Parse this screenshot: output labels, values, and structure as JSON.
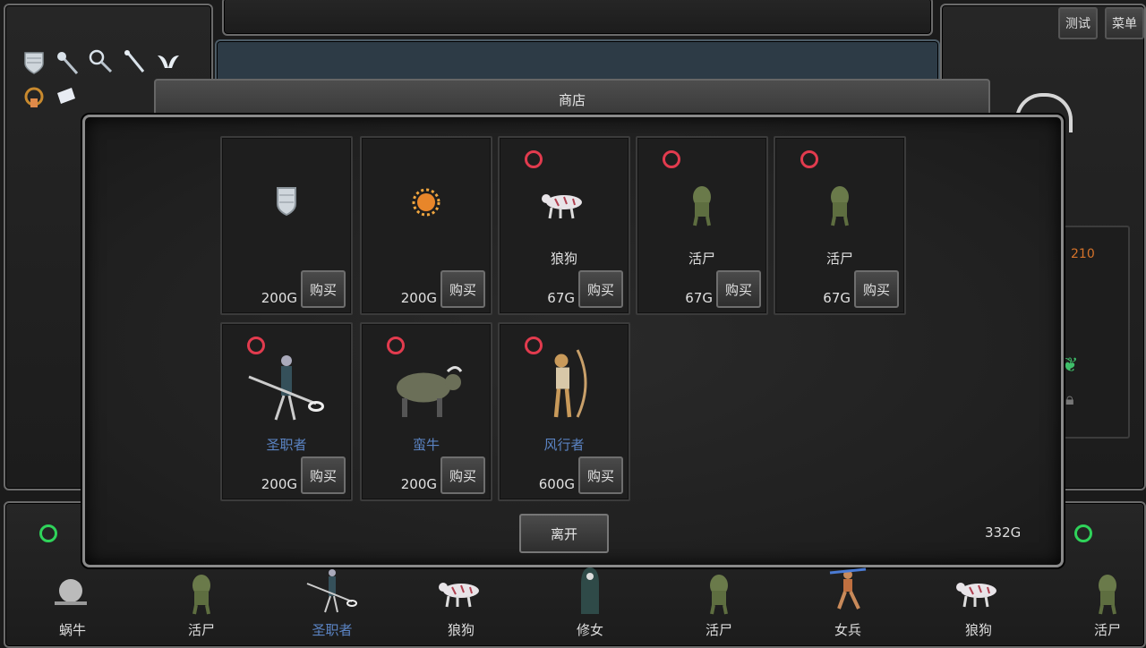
{
  "top_buttons": {
    "test": "测试",
    "menu": "菜单"
  },
  "shop": {
    "title": "商店",
    "leave_label": "离开",
    "player_gold": "332G",
    "items": [
      {
        "name": "",
        "price": "200G",
        "buy": "购买",
        "icon": "shield-icon",
        "marked": false
      },
      {
        "name": "",
        "price": "200G",
        "buy": "购买",
        "icon": "orange-burst-icon",
        "marked": false
      },
      {
        "name": "狼狗",
        "price": "67G",
        "buy": "购买",
        "icon": "wolf-dog-icon",
        "marked": true
      },
      {
        "name": "活尸",
        "price": "67G",
        "buy": "购买",
        "icon": "zombie-icon",
        "marked": true
      },
      {
        "name": "活尸",
        "price": "67G",
        "buy": "购买",
        "icon": "zombie-icon",
        "marked": true
      },
      {
        "name": "圣职者",
        "price": "200G",
        "buy": "购买",
        "icon": "cleric-icon",
        "marked": true,
        "name_color": "#5b84c4"
      },
      {
        "name": "蛮牛",
        "price": "200G",
        "buy": "购买",
        "icon": "bull-icon",
        "marked": true,
        "name_color": "#5b84c4"
      },
      {
        "name": "风行者",
        "price": "600G",
        "buy": "购买",
        "icon": "archer-icon",
        "marked": true,
        "name_color": "#5b84c4"
      }
    ]
  },
  "right_panel": {
    "value": "210"
  },
  "party": [
    {
      "name": "蜗牛",
      "icon": "snail-icon"
    },
    {
      "name": "活尸",
      "icon": "zombie-icon"
    },
    {
      "name": "圣职者",
      "icon": "cleric-icon",
      "name_color": "#5b84c4"
    },
    {
      "name": "狼狗",
      "icon": "wolf-dog-icon"
    },
    {
      "name": "修女",
      "icon": "nun-icon"
    },
    {
      "name": "活尸",
      "icon": "zombie-icon"
    },
    {
      "name": "女兵",
      "icon": "female-soldier-icon"
    },
    {
      "name": "狼狗",
      "icon": "wolf-dog-icon"
    },
    {
      "name": "活尸",
      "icon": "zombie-icon"
    }
  ]
}
